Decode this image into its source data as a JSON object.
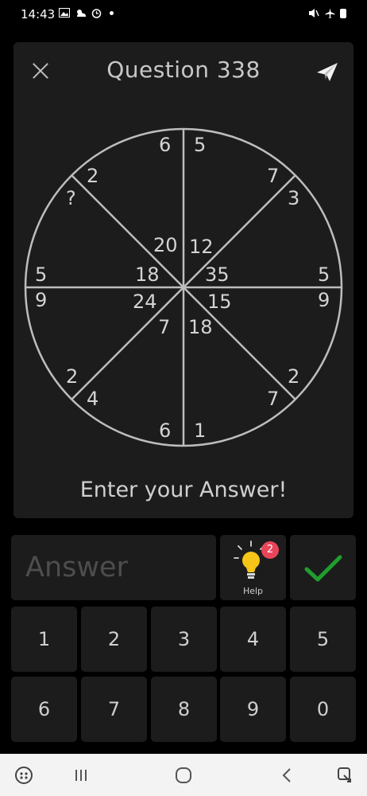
{
  "status_bar": {
    "time": "14:43",
    "left_icons": [
      "image-icon",
      "weather-icon",
      "alarm-icon",
      "notification-dot"
    ],
    "right_icons": [
      "mute-icon",
      "airplane-mode-icon",
      "battery-icon"
    ]
  },
  "question": {
    "title": "Question 338",
    "prompt": "Enter your Answer!"
  },
  "puzzle": {
    "outer_numbers": [
      "6",
      "5",
      "7",
      "3",
      "2",
      "?",
      "5",
      "9",
      "5",
      "9",
      "2",
      "7",
      "2",
      "4",
      "6",
      "1"
    ],
    "inner_numbers": [
      "20",
      "12",
      "18",
      "35",
      "24",
      "15",
      "7",
      "18"
    ]
  },
  "answer": {
    "placeholder": "Answer",
    "value": ""
  },
  "help": {
    "label": "Help",
    "badge_count": "2"
  },
  "keypad": {
    "keys": [
      "1",
      "2",
      "3",
      "4",
      "5",
      "6",
      "7",
      "8",
      "9",
      "0"
    ]
  },
  "colors": {
    "background": "#000000",
    "card": "#1c1c1c",
    "text": "#cfcfcf",
    "placeholder": "#4d4d4d",
    "check_green": "#1f9d2e",
    "bulb_yellow": "#f5c518",
    "badge_red": "#e8455a",
    "nav_bar": "#f3f3f3"
  },
  "nav_bar": {
    "items": [
      "game-launcher-icon",
      "recent-apps-icon",
      "home-icon",
      "back-icon",
      "screenshot-icon"
    ]
  }
}
